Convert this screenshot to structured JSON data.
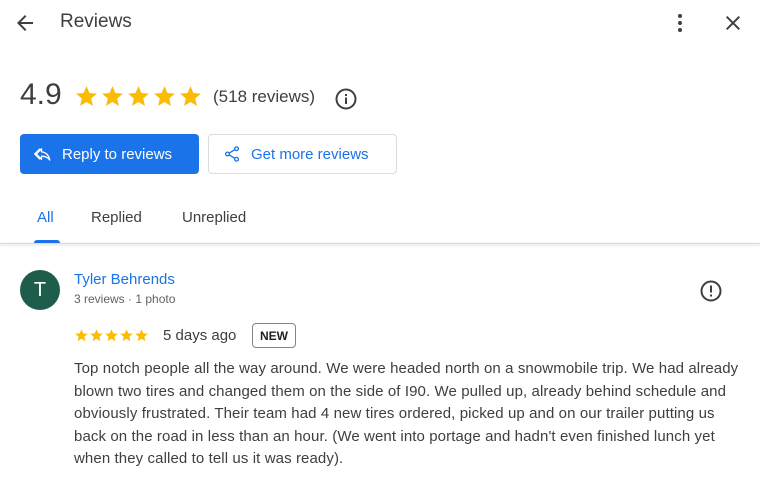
{
  "header": {
    "title": "Reviews"
  },
  "summary": {
    "rating": "4.9",
    "stars": 5,
    "count_text": "(518 reviews)"
  },
  "actions": {
    "reply_label": "Reply to reviews",
    "more_label": "Get more reviews"
  },
  "tabs": [
    {
      "label": "All",
      "active": true
    },
    {
      "label": "Replied",
      "active": false
    },
    {
      "label": "Unreplied",
      "active": false
    }
  ],
  "review": {
    "avatar_letter": "T",
    "avatar_color": "#1e5d4b",
    "name": "Tyler Behrends",
    "meta": "3 reviews · 1 photo",
    "stars": 5,
    "date": "5 days ago",
    "badge": "NEW",
    "text": "Top notch people all the way around. We were headed north on a snowmobile trip. We had already blown two tires and changed them on the side of I90. We pulled up, already behind schedule and obviously frustrated. Their team had 4 new tires ordered, picked up and on our trailer putting us back on the road in less than an hour. (We went into portage and hadn't even finished lunch yet when they called to tell us it was ready)."
  },
  "colors": {
    "accent": "#1a73e8",
    "star": "#fbbc04",
    "text": "#3c4043"
  },
  "icons": [
    "back-arrow-icon",
    "more-vert-icon",
    "close-icon",
    "info-icon",
    "reply-icon",
    "share-icon",
    "report-icon",
    "star-icon"
  ]
}
